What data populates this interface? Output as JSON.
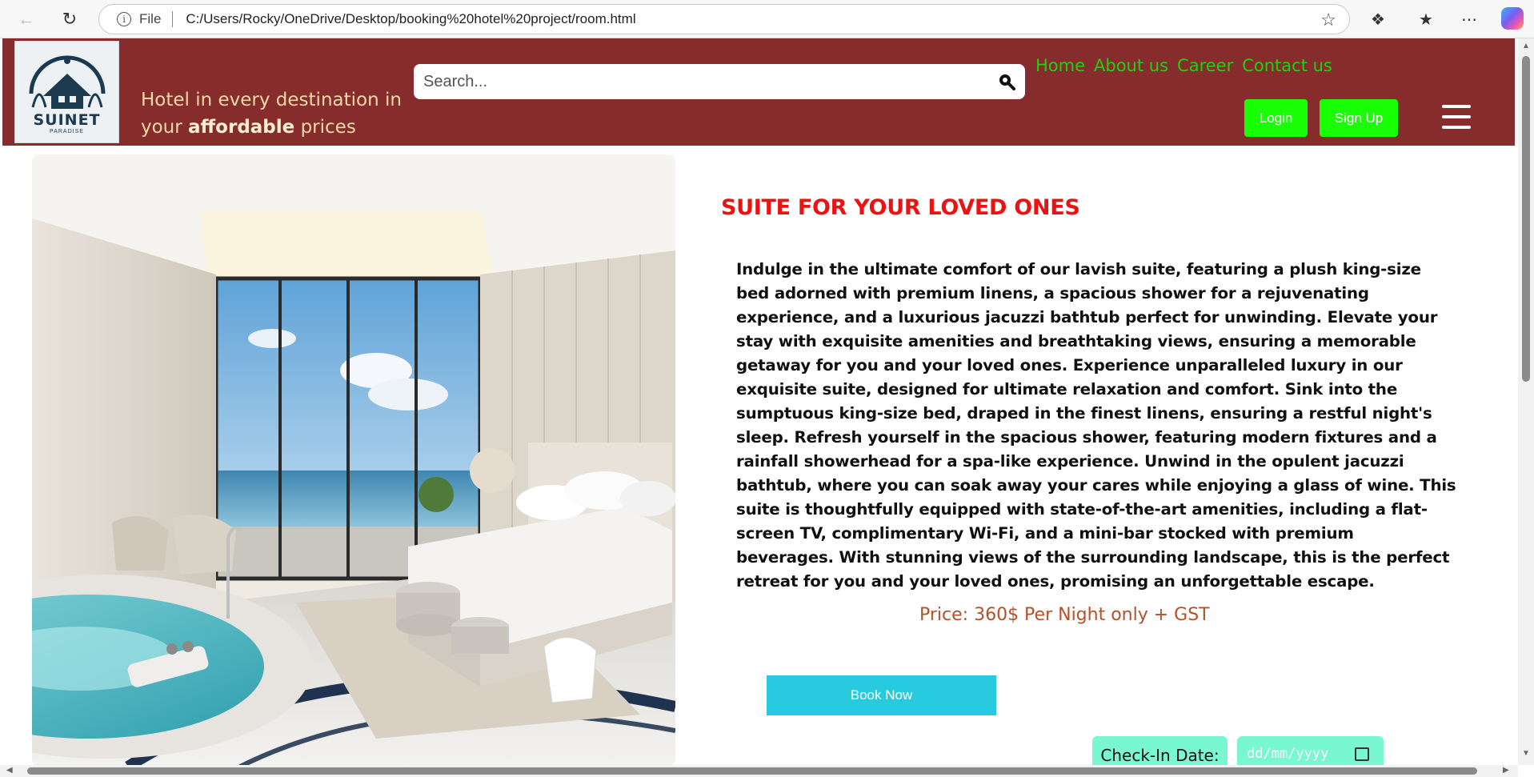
{
  "browser": {
    "file_label": "File",
    "url": "C:/Users/Rocky/OneDrive/Desktop/booking%20hotel%20project/room.html"
  },
  "header": {
    "logo_brand": "SUINET",
    "logo_sub": "PARADISE",
    "tagline_pre": "Hotel in every destination in your ",
    "tagline_bold": "affordable",
    "tagline_post": " prices",
    "search_placeholder": "Search...",
    "nav": [
      "Home",
      "About us",
      "Career",
      "Contact us"
    ],
    "login_label": "Login",
    "signup_label": "Sign Up"
  },
  "room": {
    "title": "SUITE FOR YOUR LOVED ONES",
    "description": "Indulge in the ultimate comfort of our lavish suite, featuring a plush king-size bed adorned with premium linens, a spacious shower for a rejuvenating experience, and a luxurious jacuzzi bathtub perfect for unwinding. Elevate your stay with exquisite amenities and breathtaking views, ensuring a memorable getaway for you and your loved ones. Experience unparalleled luxury in our exquisite suite, designed for ultimate relaxation and comfort. Sink into the sumptuous king-size bed, draped in the finest linens, ensuring a restful night's sleep. Refresh yourself in the spacious shower, featuring modern fixtures and a rainfall showerhead for a spa-like experience. Unwind in the opulent jacuzzi bathtub, where you can soak away your cares while enjoying a glass of wine. This suite is thoughtfully equipped with state-of-the-art amenities, including a flat-screen TV, complimentary Wi-Fi, and a mini-bar stocked with premium beverages. With stunning views of the surrounding landscape, this is the perfect retreat for you and your loved ones, promising an unforgettable escape.",
    "price": "Price: 360$ Per Night only + GST",
    "book_label": "Book Now",
    "checkin_label": "Check-In Date:",
    "date_placeholder": "dd/mm/yyyy"
  },
  "colors": {
    "header_bg": "#862c2d",
    "nav_link": "#22d00f",
    "auth_button": "#19ff05",
    "title": "#ee1111",
    "price": "#b25228",
    "book_button": "#27cadf",
    "checkin_bg": "#78f7d1"
  }
}
